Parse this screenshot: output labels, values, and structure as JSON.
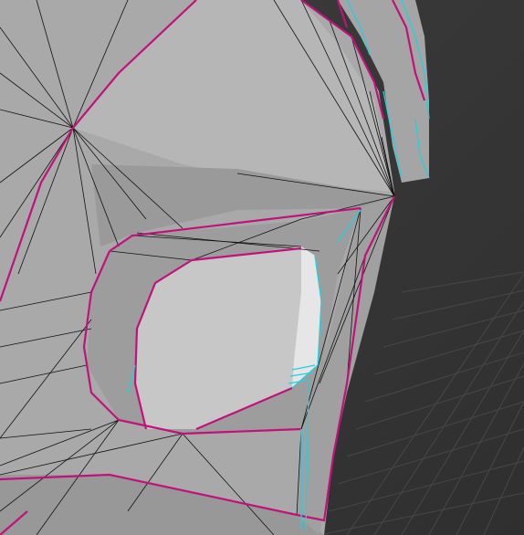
{
  "viewport": {
    "background": "#3a3a3a",
    "grid_color": "#4a4a4a",
    "mesh_fill": "#a9a9a9",
    "mesh_fill_light": "#bdbdbd",
    "mesh_fill_dark": "#8e8e8e",
    "wire_color": "#111111",
    "seam_color": "#c0127a",
    "edge_highlight_color": "#22d0e0"
  }
}
